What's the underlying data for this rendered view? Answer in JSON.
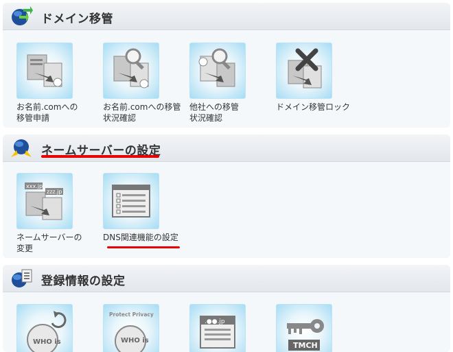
{
  "sections": [
    {
      "title": "ドメイン移管",
      "items": [
        {
          "label": "お名前.comへの\n移管申請"
        },
        {
          "label": "お名前.comへの移管\n状況確認"
        },
        {
          "label": "他社への移管\n状況確認"
        },
        {
          "label": "ドメイン移管ロック"
        }
      ]
    },
    {
      "title": "ネームサーバーの設定",
      "items": [
        {
          "label": "ネームサーバーの\n変更",
          "icon_text_1": "xxx.jp",
          "icon_text_2": "zzz.jp"
        },
        {
          "label": "DNS関連機能の設定"
        }
      ]
    },
    {
      "title": "登録情報の設定",
      "items": [
        {
          "label": "",
          "icon_text": "WHO is"
        },
        {
          "label": "",
          "icon_text_top": "Protect Privacy",
          "icon_text": "WHO is"
        },
        {
          "label": "",
          "icon_text": ".●●.jp"
        },
        {
          "label": "",
          "icon_text": "TMCH"
        }
      ]
    }
  ],
  "colors": {
    "highlight_underline": "#e60000",
    "tile_blue": "#a7dcf4"
  }
}
